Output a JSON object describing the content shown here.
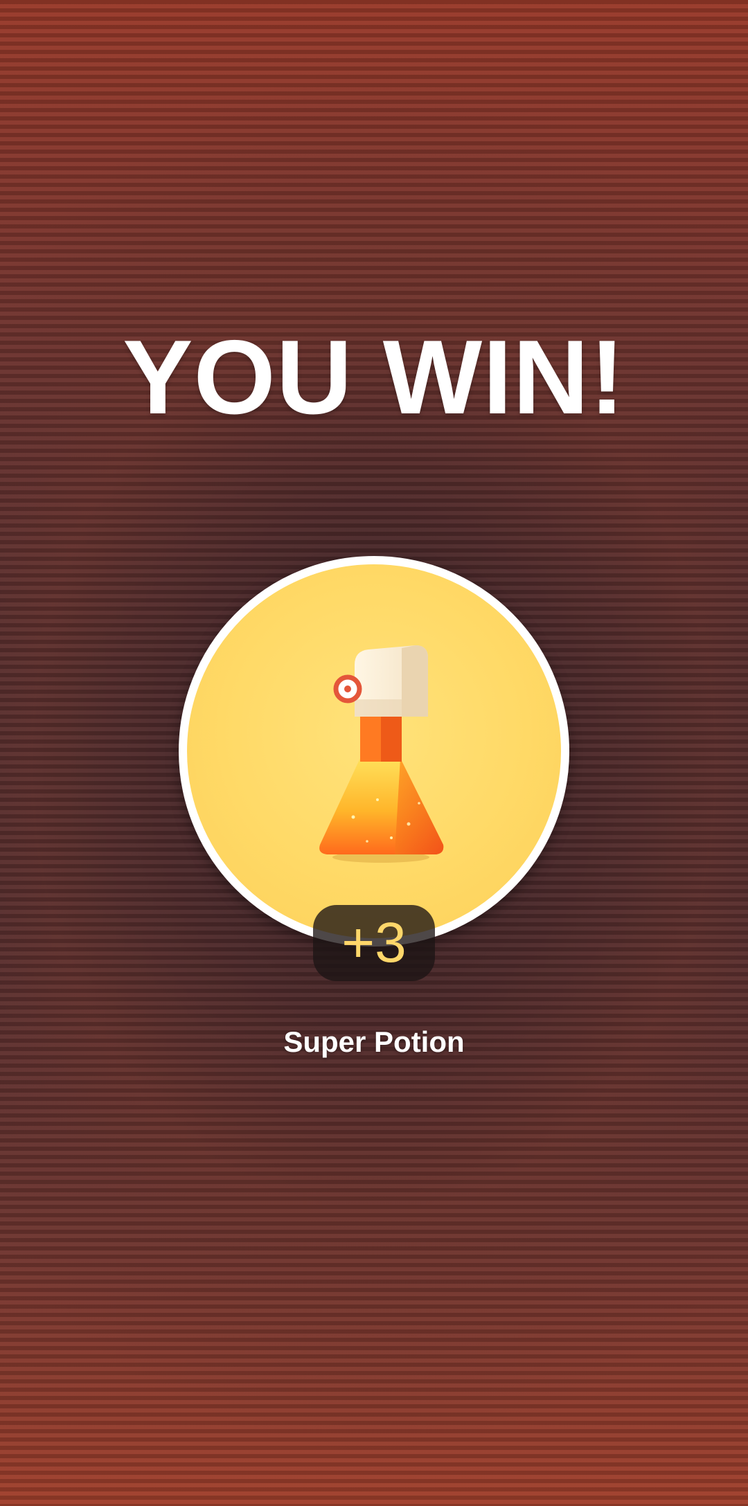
{
  "result": {
    "title": "YOU WIN!"
  },
  "reward": {
    "icon": "super-potion-icon",
    "count_label": "+3",
    "item_name": "Super Potion"
  },
  "colors": {
    "background_edge": "#9a3a2a",
    "background_center": "#4a2c30",
    "circle_fill": "#ffd966",
    "circle_border": "#ffffff",
    "count_text": "#ffd76a"
  }
}
